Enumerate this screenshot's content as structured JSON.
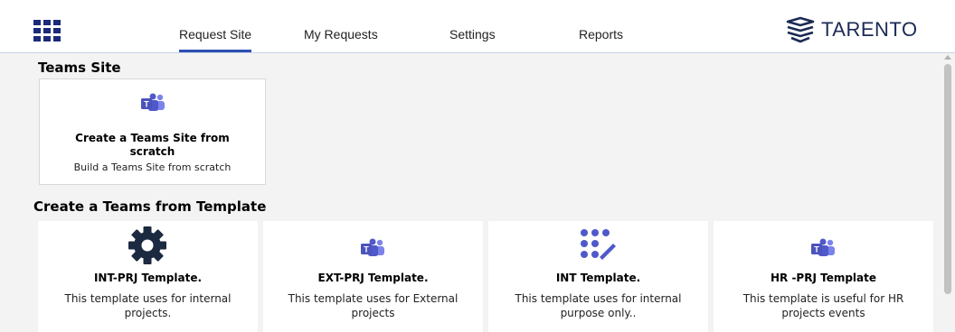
{
  "header": {
    "tabs": [
      {
        "label": "Request Site",
        "active": true
      },
      {
        "label": "My Requests",
        "active": false
      },
      {
        "label": "Settings",
        "active": false
      },
      {
        "label": "Reports",
        "active": false
      }
    ],
    "logo_text": "TARENTO",
    "waffle_icon": "app-launcher-icon"
  },
  "colors": {
    "accent": "#2b4fb0",
    "teams_purple": "#5059c9",
    "teams_purple_light": "#7b83eb",
    "gear": "#1b2a40",
    "logo": "#1b2a55",
    "background": "#f3f3f3"
  },
  "teams_site": {
    "section_title": "Teams Site",
    "card": {
      "icon": "teams-icon",
      "title": "Create a Teams Site from scratch",
      "description": "Build a Teams Site from scratch"
    }
  },
  "templates": {
    "section_title": "Create a Teams from Template",
    "items": [
      {
        "icon": "gear-icon",
        "title": "INT-PRJ Template.",
        "description": "This template uses for internal projects."
      },
      {
        "icon": "teams-icon",
        "title": "EXT-PRJ Template.",
        "description": "This template uses for External projects"
      },
      {
        "icon": "dots-wand-icon",
        "title": "INT Template.",
        "description": "This template uses for internal purpose only.."
      },
      {
        "icon": "teams-icon",
        "title": "HR -PRJ Template",
        "description": "This template is useful for HR projects events"
      }
    ]
  }
}
